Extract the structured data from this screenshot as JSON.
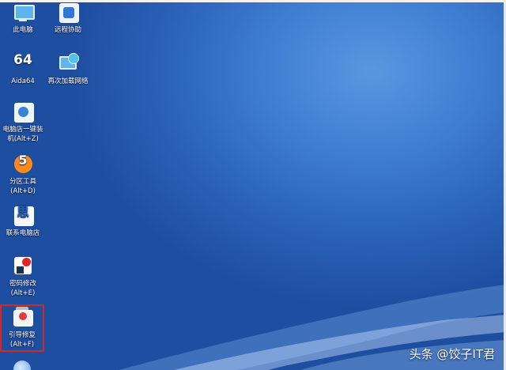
{
  "desktop": {
    "icons": [
      {
        "label": "此电脑",
        "icon": "this-pc-icon"
      },
      {
        "label": "远程协助",
        "icon": "remote-assist-icon"
      },
      {
        "label": "Aida64",
        "icon": "aida64-icon"
      },
      {
        "label": "再次加载网络",
        "icon": "network-reload-icon"
      },
      {
        "label": "电脑店一键装",
        "label2": "机(Alt+Z)",
        "icon": "one-click-install-icon"
      },
      {
        "label": "分区工具",
        "label2": "(Alt+D)",
        "icon": "partition-tool-icon"
      },
      {
        "label": "联系电脑店",
        "icon": "contact-store-icon"
      },
      {
        "label": "密码修改",
        "label2": "(Alt+E)",
        "icon": "password-tool-icon"
      },
      {
        "label": "引导修复",
        "label2": "(Alt+F)",
        "icon": "boot-repair-icon",
        "selected": true
      }
    ],
    "aida_glyph_text": "64",
    "contact_glyph_text": "思",
    "partition_glyph_text": "5"
  },
  "watermark": {
    "text": "头条 @饺子IT君"
  },
  "colors": {
    "wallpaper": "#2a62b8",
    "selection_outline": "#d12a2a"
  }
}
